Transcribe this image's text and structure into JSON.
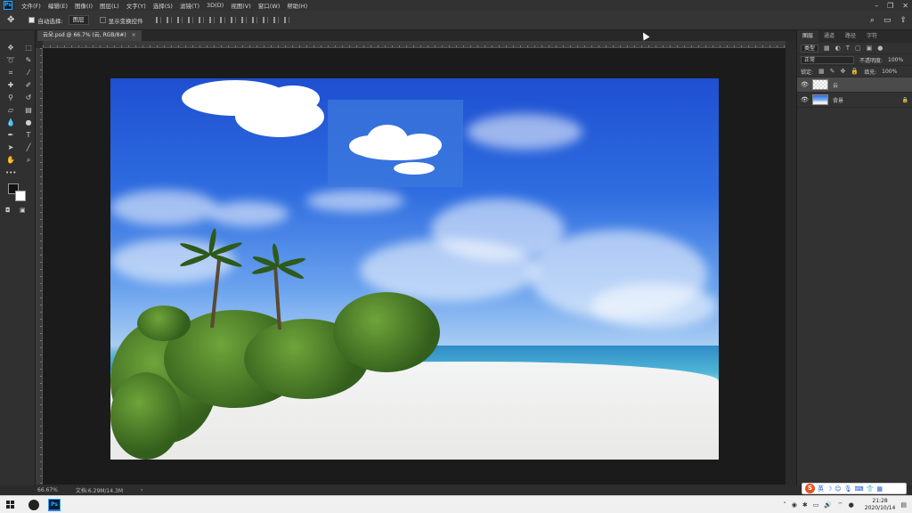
{
  "app": {
    "logo_text": "Ps"
  },
  "menu": {
    "items": [
      "文件(F)",
      "编辑(E)",
      "图像(I)",
      "图层(L)",
      "文字(Y)",
      "选择(S)",
      "滤镜(T)",
      "3D(D)",
      "视图(V)",
      "窗口(W)",
      "帮助(H)"
    ]
  },
  "options_bar": {
    "auto_select_label": "自动选择:",
    "auto_select_target": "图层",
    "show_transform_label": "显示变换控件"
  },
  "document": {
    "tab_title": "云朵.psd @ 66.7% (云, RGB/8#)",
    "zoom": "66.67%",
    "doc_info": "文档:6.29M/14.3M"
  },
  "panels": {
    "tabs": [
      "图层",
      "通道",
      "路径",
      "字符"
    ],
    "kind_filter": "类型",
    "blend_mode": "正常",
    "opacity_label": "不透明度:",
    "opacity_value": "100%",
    "lock_label": "锁定:",
    "fill_label": "填充:",
    "fill_value": "100%",
    "layers": [
      {
        "name": "云",
        "visible": true,
        "selected": true
      },
      {
        "name": "背景",
        "visible": true,
        "selected": false,
        "locked": true
      }
    ]
  },
  "ime": {
    "logo": "S",
    "mode": "英"
  },
  "taskbar": {
    "time": "21:28",
    "date": "2020/10/14"
  },
  "colors": {
    "foreground": "#111111",
    "background": "#ffffff",
    "ps_accent": "#31a8ff"
  }
}
